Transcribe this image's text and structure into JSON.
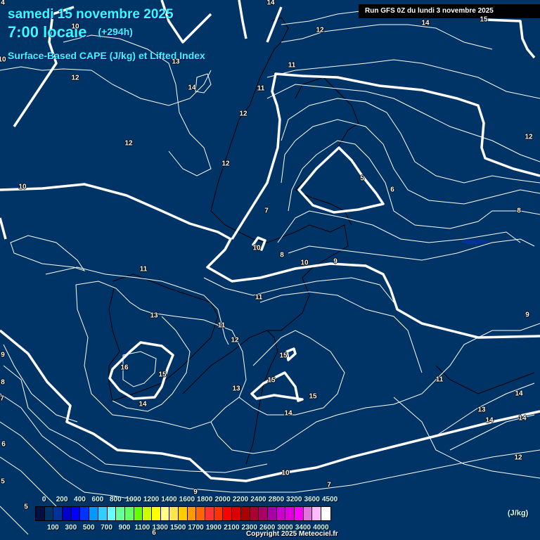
{
  "header": {
    "date": "samedi 15 novembre 2025",
    "time": "7:00 locale",
    "lead": "(+294h)",
    "field": "Surface-Based CAPE (J/kg) et Lifted Index",
    "run": "Run GFS 0Z du lundi 3 novembre 2025"
  },
  "contour_labels": [
    "4",
    "10",
    "14",
    "12",
    "14",
    "15",
    "13",
    "11",
    "12",
    "14",
    "11",
    "12",
    "12",
    "12",
    "12",
    "10",
    "5",
    "6",
    "7",
    "8",
    "10",
    "8",
    "10",
    "9",
    "11",
    "11",
    "13",
    "9",
    "11",
    "12",
    "15",
    "16",
    "15",
    "9",
    "15",
    "11",
    "13",
    "8",
    "15",
    "14",
    "7",
    "14",
    "13",
    "14",
    "14",
    "14",
    "6",
    "12",
    "10",
    "5",
    "9",
    "7",
    "5",
    "6",
    "10"
  ],
  "legend": {
    "unit": "(J/kg)",
    "top_ticks": [
      "0",
      "200",
      "400",
      "600",
      "800",
      "1000",
      "1200",
      "1400",
      "1600",
      "1800",
      "2000",
      "2200",
      "2400",
      "2800",
      "3200",
      "3600",
      "4500"
    ],
    "bottom_ticks": [
      "100",
      "300",
      "500",
      "700",
      "900",
      "1100",
      "1300",
      "1500",
      "1700",
      "1900",
      "2100",
      "2300",
      "2600",
      "3000",
      "3400",
      "4000"
    ],
    "colors": [
      "#001040",
      "#003366",
      "#003399",
      "#0000cc",
      "#0000ff",
      "#0033ff",
      "#0099ff",
      "#33ccff",
      "#66ffff",
      "#66ff99",
      "#66ff66",
      "#66ff00",
      "#ccff00",
      "#ffff00",
      "#ffff88",
      "#ffe64d",
      "#ffcc00",
      "#ff9900",
      "#ff6600",
      "#ff3333",
      "#ff3300",
      "#ff0000",
      "#dd0000",
      "#aa0000",
      "#aa0033",
      "#aa0066",
      "#aa00aa",
      "#cc00cc",
      "#dd00dd",
      "#ff00ff",
      "#dd77dd",
      "#ffbbff",
      "#ffffff"
    ]
  },
  "copyright": "Copyright 2025 Meteociel.fr"
}
